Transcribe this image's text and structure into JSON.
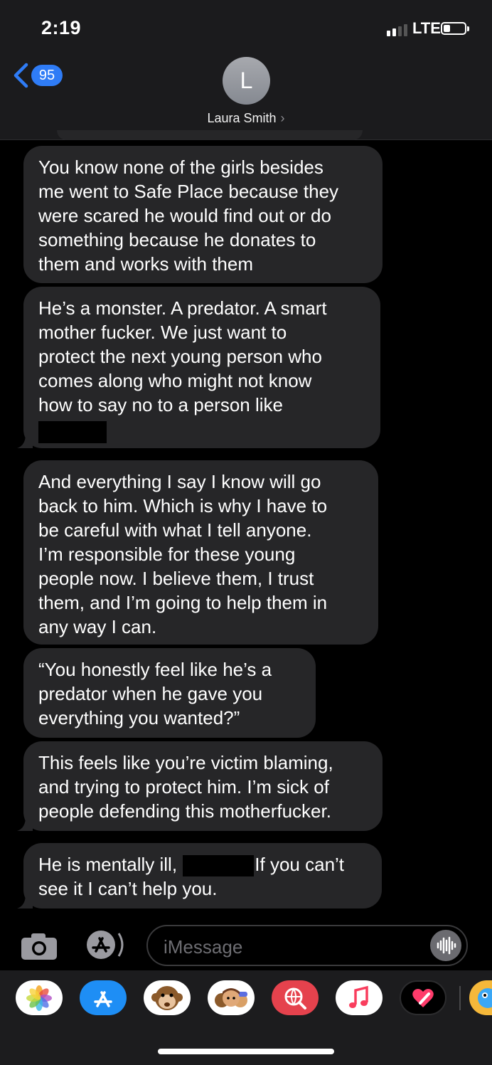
{
  "status_bar": {
    "time": "2:19",
    "carrier": "LTE"
  },
  "header": {
    "back_count": "95",
    "avatar_initial": "L",
    "contact_name": "Laura Smith",
    "contact_chevron": "›"
  },
  "messages": [
    {
      "text": "You know none of the girls besides\nme went to Safe Place because they\nwere scared he would find out or do\nsomething because he donates to\nthem and works with them"
    },
    {
      "text": "He’s a monster. A predator. A smart\nmother fucker. We just want to\nprotect the next young person who\ncomes along who might not know\nhow to say no to a person like"
    },
    {
      "text": "And everything I say I know will go\nback to him. Which is why I have to\nbe careful with what I tell anyone.\nI’m responsible for these young\npeople now. I believe them, I trust\nthem, and I’m going to help them in\nany way I can."
    },
    {
      "text": "“You honestly feel like he’s a\npredator when he gave you\neverything you wanted?”"
    },
    {
      "text": "This feels like you’re victim blaming,\nand trying to protect him. I’m sick of\npeople defending this motherfucker."
    },
    {
      "text_before": "He is mentally ill,",
      "text_after": "If you can’t",
      "text_line2": "see it I can’t help you."
    }
  ],
  "composer": {
    "placeholder": "iMessage"
  },
  "app_drawer": [
    "photos-app",
    "app-store",
    "animoji",
    "memoji",
    "web-images",
    "music",
    "digital-touch",
    "more-apps"
  ],
  "colors": {
    "bubble": "#262628",
    "accent": "#2f7cf6",
    "background": "#000000"
  }
}
